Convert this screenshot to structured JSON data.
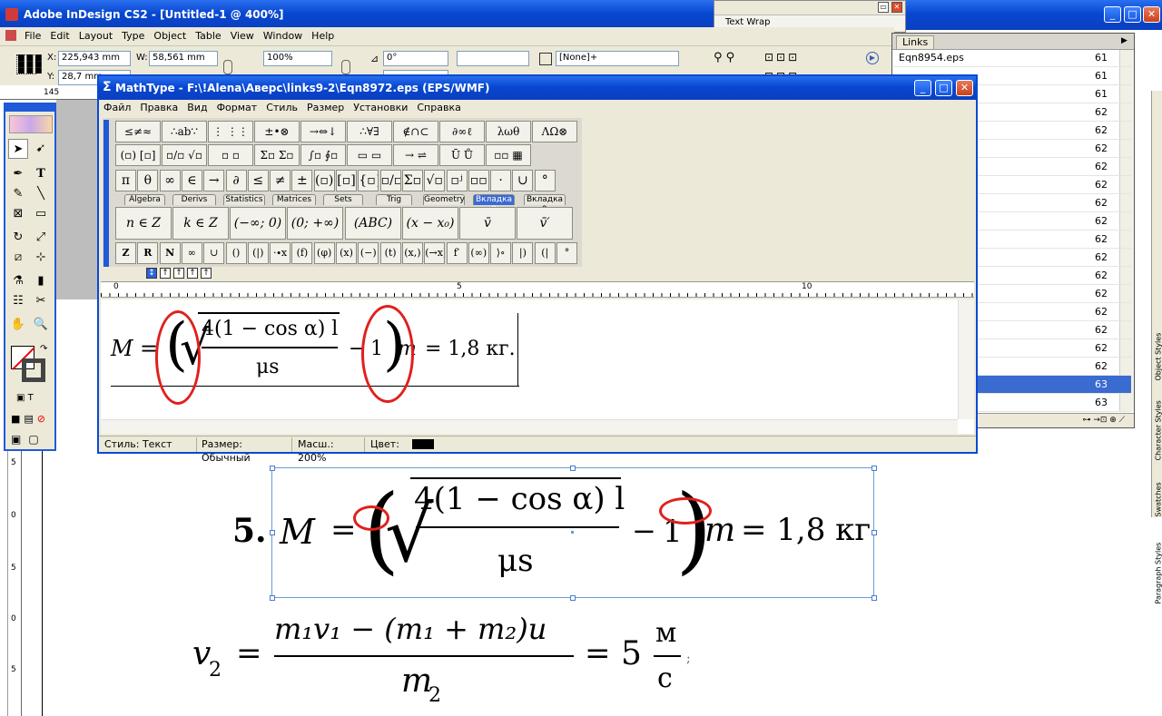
{
  "indesign": {
    "title": "Adobe InDesign CS2 - [Untitled-1 @ 400%]",
    "menu": [
      "File",
      "Edit",
      "Layout",
      "Type",
      "Object",
      "Table",
      "View",
      "Window",
      "Help"
    ],
    "control": {
      "x_label": "X:",
      "x": "225,943 mm",
      "y_label": "Y:",
      "y": "28,7 mm",
      "w_label": "W:",
      "w": "58,561 mm",
      "scale": "100%",
      "angle": "0°",
      "style": "[None]+"
    },
    "ruler_mark": "145"
  },
  "text_wrap": {
    "title": "Text Wrap"
  },
  "links_panel": {
    "tab": "Links",
    "first_file": "Eqn8954.eps",
    "pages": [
      "61",
      "61",
      "61",
      "62",
      "62",
      "62",
      "62",
      "62",
      "62",
      "62",
      "62",
      "62",
      "62",
      "62",
      "62",
      "62",
      "62",
      "62",
      "63",
      "63"
    ],
    "selected_index": 18
  },
  "side_tabs": [
    "Object Styles",
    "Character Styles",
    "Swatches",
    "Paragraph Styles"
  ],
  "vruler": [
    "5",
    "0",
    "5",
    "0",
    "5"
  ],
  "mathtype": {
    "title": "MathType - F:\\!Alena\\Аверс\\links9-2\\Eqn8972.eps (EPS/WMF)",
    "menu": [
      "Файл",
      "Правка",
      "Вид",
      "Формат",
      "Стиль",
      "Размер",
      "Установки",
      "Справка"
    ],
    "row1": [
      "≤≠≈",
      "∴ab∵",
      "⋮ ⋮⋮",
      "±•⊗",
      "→⇔↓",
      "∴∀∃",
      "∉∩⊂",
      "∂∞ℓ",
      "λωθ",
      "ΛΩ⊗"
    ],
    "row2": [
      "(▫) [▫]",
      "▫/▫ √▫",
      "▫ ▫",
      "Σ▫ Σ▫",
      "∫▫ ∮▫",
      "▭ ▭",
      "→ ⇌",
      "Ū Ů",
      "▫▫ ▦"
    ],
    "row3": [
      "π",
      "θ",
      "∞",
      "∈",
      "→",
      "∂",
      "≤",
      "≠",
      "±",
      "(▫)",
      "[▫]",
      "{▫}",
      "▫/▫",
      "Σ▫",
      "√▫",
      "▫ʲ",
      "▫▫",
      "·",
      "∪",
      "°"
    ],
    "tabs": [
      "Algebra",
      "Derivs",
      "Statistics",
      "Matrices",
      "Sets",
      "Trig",
      "Geometry",
      "Вкладка 8",
      "Вкладка 9"
    ],
    "active_tab": "Вкладка 8",
    "templates": [
      "n ∈ Z",
      "k ∈ Z",
      "(−∞; 0)",
      "(0; +∞)",
      "(ABC)",
      "(x − x₀)",
      "v̄",
      "v̄′"
    ],
    "row4": [
      "Z",
      "R",
      "N",
      "∞",
      "∪",
      "()",
      "(|)",
      "·∙x",
      "(f)",
      "(φ)",
      "(x)",
      "(−)",
      "(t)",
      "(x,)",
      "(→x)",
      "f′",
      "(∞)",
      "⟩∘",
      "|)",
      "(|",
      "°"
    ],
    "ruler": [
      "0",
      "5",
      "10"
    ],
    "equation": {
      "lhs": "M",
      "eq": "=",
      "num": "4(1 − cos α) l",
      "den": "μs",
      "minus": "−",
      "one": "1",
      "m": "m",
      "rhs": "= 1,8 кг."
    },
    "status": {
      "style": "Стиль: Текст",
      "size": "Размер: Обычный",
      "zoom": "Масш.: 200%",
      "color": "Цвет:"
    }
  },
  "page": {
    "problem_number": "5.",
    "eq1": {
      "lhs": "M",
      "eq": "=",
      "num": "4(1 − cos α) l",
      "den": "μs",
      "minus": "−",
      "one": "1",
      "m": "m",
      "rhs": "= 1,8 кг"
    },
    "eq2": {
      "lhs": "v",
      "lhs_sub": "2",
      "eq": "=",
      "num": "m₁v₁ − (m₁ + m₂)u",
      "den": "m",
      "den_sub": "2",
      "eq2": "=",
      "val": "5",
      "unit_num": "м",
      "unit_den": "с",
      "tail": ";"
    }
  }
}
